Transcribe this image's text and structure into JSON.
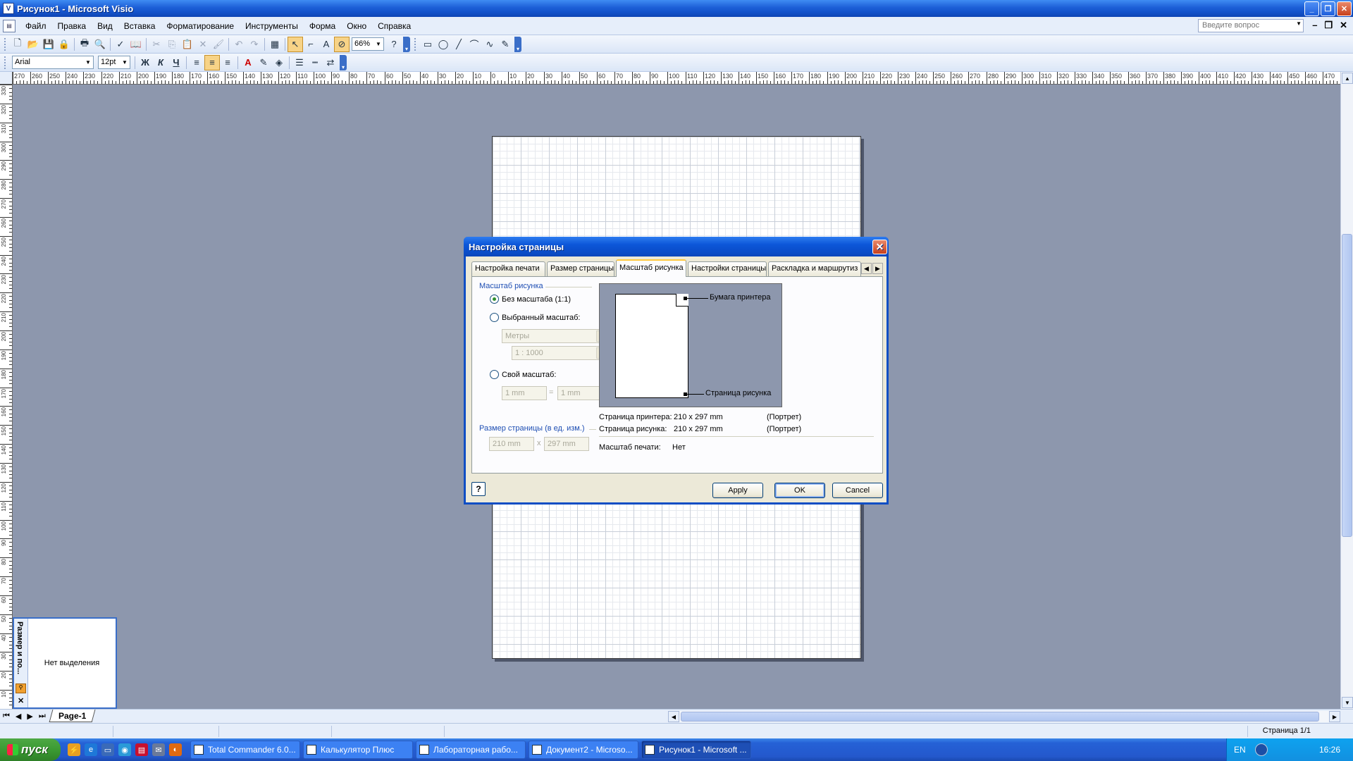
{
  "window": {
    "title": "Рисунок1 - Microsoft Visio",
    "app_icon_glyph": "V"
  },
  "menu": {
    "items": [
      "Файл",
      "Правка",
      "Вид",
      "Вставка",
      "Форматирование",
      "Инструменты",
      "Форма",
      "Окно",
      "Справка"
    ],
    "help_placeholder": "Введите вопрос"
  },
  "toolbar1": {
    "zoom": "66%"
  },
  "toolbar2": {
    "font": "Arial",
    "size": "12pt",
    "bold": "Ж",
    "italic": "К",
    "underline": "Ч"
  },
  "ruler": {
    "h_labels": [
      "270",
      "260",
      "250",
      "240",
      "230",
      "220",
      "210",
      "200",
      "190",
      "180",
      "170",
      "160",
      "150",
      "140",
      "130",
      "120",
      "110",
      "100",
      "90",
      "80",
      "70",
      "60",
      "50",
      "40",
      "30",
      "20",
      "10",
      "0",
      "10",
      "20",
      "30",
      "40",
      "50",
      "60",
      "70",
      "80",
      "90",
      "100",
      "110",
      "120",
      "130",
      "140",
      "150",
      "160",
      "170",
      "180",
      "190",
      "200",
      "210",
      "220",
      "230",
      "240",
      "250",
      "260",
      "270",
      "280",
      "290",
      "300",
      "310",
      "320",
      "330",
      "340",
      "350",
      "360",
      "370",
      "380",
      "390",
      "400",
      "410",
      "420",
      "430",
      "440",
      "450",
      "460",
      "470"
    ],
    "v_labels": [
      "330",
      "320",
      "310",
      "300",
      "290",
      "280",
      "270",
      "260",
      "250",
      "240",
      "230",
      "220",
      "210",
      "200",
      "190",
      "180",
      "170",
      "160",
      "150",
      "140",
      "130",
      "120",
      "110",
      "100",
      "90",
      "80",
      "70",
      "60",
      "50",
      "40",
      "30",
      "20",
      "10"
    ]
  },
  "size_panel": {
    "title": "Размер и по...",
    "message": "Нет выделения"
  },
  "page_tab": "Page-1",
  "status": {
    "page": "Страница 1/1"
  },
  "dialog": {
    "title": "Настройка страницы",
    "tabs": [
      "Настройка печати",
      "Размер страницы",
      "Масштаб рисунка",
      "Настройки страницы",
      "Раскладка и маршрутиз"
    ],
    "scale_group": "Масштаб рисунка",
    "radio_none": "Без масштаба (1:1)",
    "radio_preset": "Выбранный масштаб:",
    "preset_units": "Метры",
    "preset_ratio": "1 : 1000",
    "radio_custom": "Свой масштаб:",
    "custom_left": "1 mm",
    "custom_right": "1 mm",
    "equals": "=",
    "pagesize_group": "Размер страницы (в ед. изм.)",
    "pagesize_w": "210 mm",
    "pagesize_x": "x",
    "pagesize_h": "297 mm",
    "preview_printer": "Бумага принтера",
    "preview_drawing": "Страница рисунка",
    "printer_label": "Страница принтера:",
    "printer_size": "210 x 297 mm",
    "printer_orient": "(Портрет)",
    "drawing_label": "Страница рисунка:",
    "drawing_size": "210 x 297 mm",
    "drawing_orient": "(Портрет)",
    "printscale_label": "Масштаб печати:",
    "printscale_value": "Нет",
    "apply": "Apply",
    "ok": "OK",
    "cancel": "Cancel"
  },
  "taskbar": {
    "start": "пуск",
    "tasks": [
      "Total Commander 6.0...",
      "Калькулятор Плюс",
      "Лабораторная рабо...",
      "Документ2 - Microso...",
      "Рисунок1 - Microsoft ..."
    ],
    "lang": "EN",
    "clock": "16:26"
  }
}
